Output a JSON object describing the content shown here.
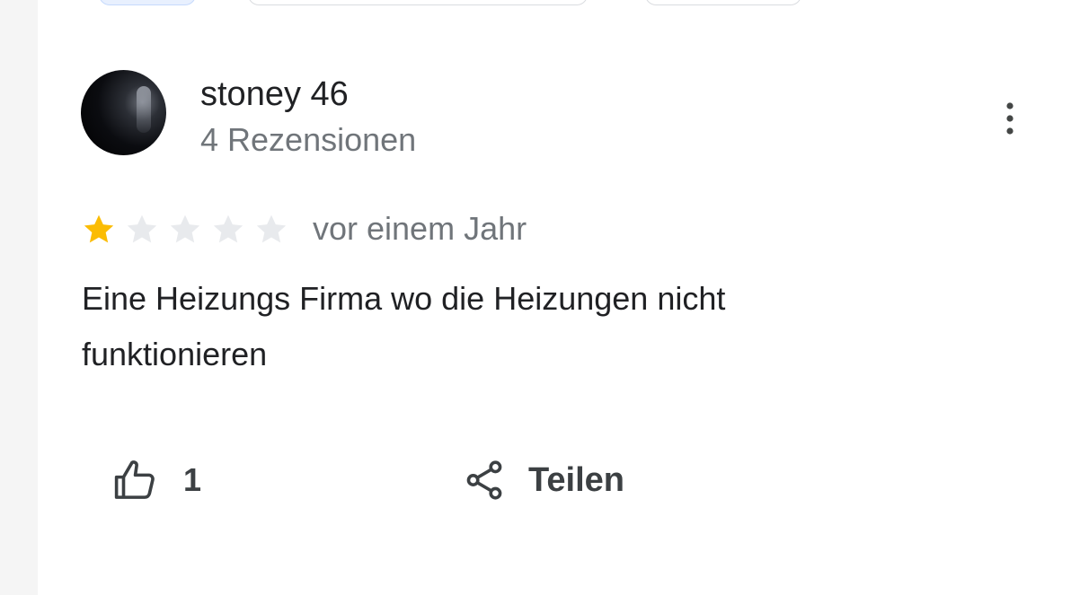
{
  "review": {
    "author": {
      "name": "stoney 46",
      "reviews_count": "4 Rezensionen"
    },
    "rating": {
      "value": 1,
      "max": 5,
      "filled_color": "#fbbc04",
      "empty_color": "#e8eaed"
    },
    "date": "vor einem Jahr",
    "text": "Eine Heizungs Firma wo die Heizungen nicht funktionieren"
  },
  "actions": {
    "like_count": "1",
    "share_label": "Teilen"
  },
  "icons": {
    "more": "more-vert-icon",
    "like": "thumb-up-icon",
    "share": "share-icon",
    "star": "star-icon"
  }
}
